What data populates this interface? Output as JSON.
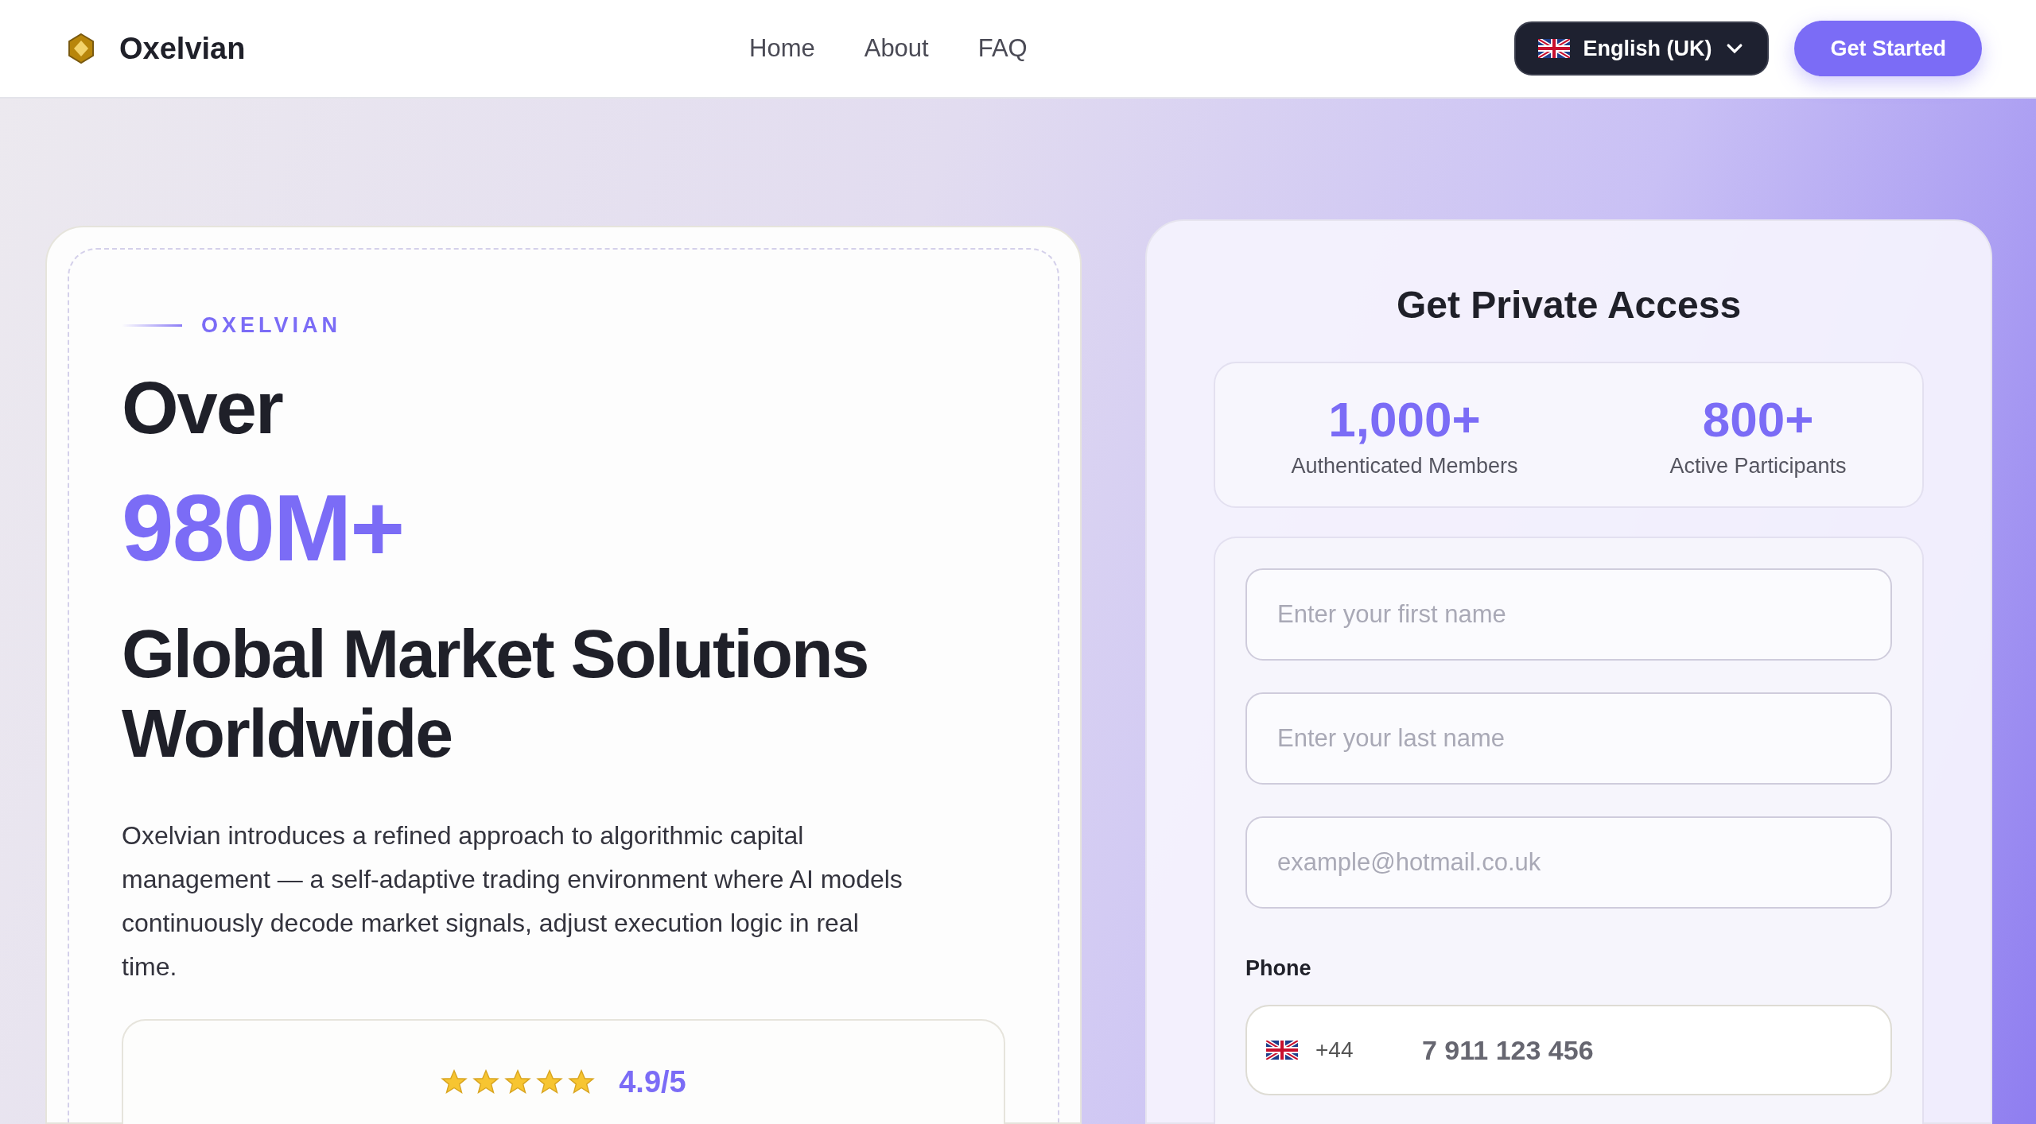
{
  "header": {
    "brand": "Oxelvian",
    "nav": [
      {
        "label": "Home"
      },
      {
        "label": "About"
      },
      {
        "label": "FAQ"
      }
    ],
    "language": "English (UK)",
    "cta": "Get Started"
  },
  "hero": {
    "eyebrow": "OXELVIAN",
    "line_1": "Over",
    "highlight": "980M+",
    "heading": "Global Market Solutions Worldwide",
    "description": "Oxelvian introduces a refined approach to algorithmic capital management — a self-adaptive trading environment where AI models continuously decode market signals, adjust execution logic in real time.",
    "rating": {
      "stars": 5,
      "score": "4.9/5"
    }
  },
  "form": {
    "title": "Get Private Access",
    "stats": [
      {
        "value": "1,000+",
        "label": "Authenticated Members"
      },
      {
        "value": "800+",
        "label": "Active Participants"
      }
    ],
    "fields": [
      {
        "placeholder": "Enter your first name"
      },
      {
        "placeholder": "Enter your last name"
      },
      {
        "placeholder": "example@hotmail.co.uk"
      }
    ],
    "phone": {
      "label": "Phone",
      "code": "+44",
      "value": "7 911 123 456"
    }
  }
}
